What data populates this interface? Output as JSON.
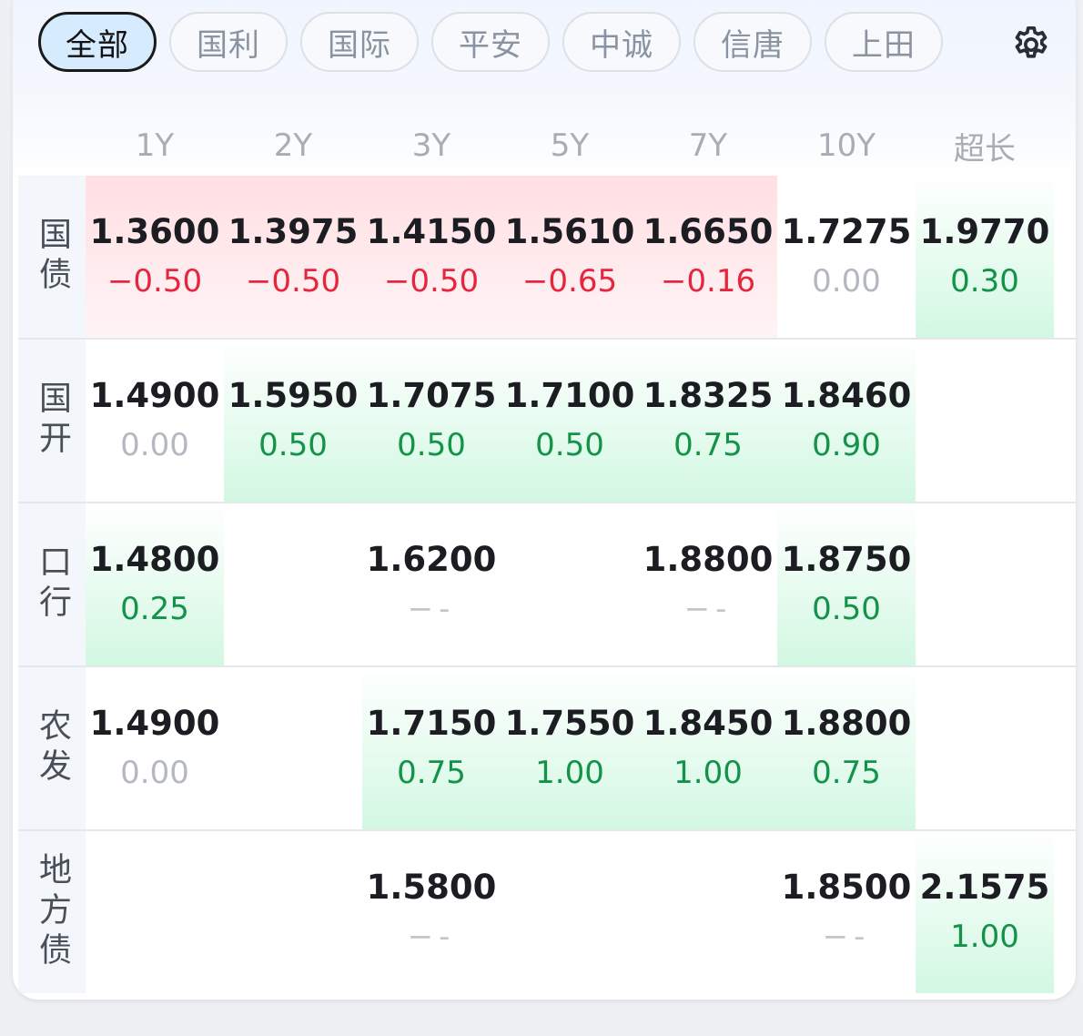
{
  "tabs": [
    {
      "label": "全部",
      "active": true
    },
    {
      "label": "国利",
      "active": false
    },
    {
      "label": "国际",
      "active": false
    },
    {
      "label": "平安",
      "active": false
    },
    {
      "label": "中诚",
      "active": false
    },
    {
      "label": "信唐",
      "active": false
    },
    {
      "label": "上田",
      "active": false
    }
  ],
  "settings_icon": "gear-icon",
  "columns": [
    "1Y",
    "2Y",
    "3Y",
    "5Y",
    "7Y",
    "10Y",
    "超长"
  ],
  "rows": [
    {
      "label": "国债",
      "cells": [
        {
          "rate": "1.3600",
          "change": "-0.50",
          "trend": "down"
        },
        {
          "rate": "1.3975",
          "change": "-0.50",
          "trend": "down"
        },
        {
          "rate": "1.4150",
          "change": "-0.50",
          "trend": "down"
        },
        {
          "rate": "1.5610",
          "change": "-0.65",
          "trend": "down"
        },
        {
          "rate": "1.6650",
          "change": "-0.16",
          "trend": "down"
        },
        {
          "rate": "1.7275",
          "change": "0.00",
          "trend": "flat"
        },
        {
          "rate": "1.9770",
          "change": "0.30",
          "trend": "up"
        }
      ]
    },
    {
      "label": "国开",
      "cells": [
        {
          "rate": "1.4900",
          "change": "0.00",
          "trend": "flat"
        },
        {
          "rate": "1.5950",
          "change": "0.50",
          "trend": "up"
        },
        {
          "rate": "1.7075",
          "change": "0.50",
          "trend": "up"
        },
        {
          "rate": "1.7100",
          "change": "0.50",
          "trend": "up"
        },
        {
          "rate": "1.8325",
          "change": "0.75",
          "trend": "up"
        },
        {
          "rate": "1.8460",
          "change": "0.90",
          "trend": "up"
        },
        null
      ]
    },
    {
      "label": "口行",
      "cells": [
        {
          "rate": "1.4800",
          "change": "0.25",
          "trend": "up"
        },
        null,
        {
          "rate": "1.6200",
          "change": "--",
          "trend": "na"
        },
        null,
        {
          "rate": "1.8800",
          "change": "--",
          "trend": "na"
        },
        {
          "rate": "1.8750",
          "change": "0.50",
          "trend": "up"
        },
        null
      ]
    },
    {
      "label": "农发",
      "cells": [
        {
          "rate": "1.4900",
          "change": "0.00",
          "trend": "flat"
        },
        null,
        {
          "rate": "1.7150",
          "change": "0.75",
          "trend": "up"
        },
        {
          "rate": "1.7550",
          "change": "1.00",
          "trend": "up"
        },
        {
          "rate": "1.8450",
          "change": "1.00",
          "trend": "up"
        },
        {
          "rate": "1.8800",
          "change": "0.75",
          "trend": "up"
        },
        null
      ]
    },
    {
      "label": "地方债",
      "cells": [
        null,
        null,
        {
          "rate": "1.5800",
          "change": "--",
          "trend": "na"
        },
        null,
        null,
        {
          "rate": "1.8500",
          "change": "--",
          "trend": "na"
        },
        {
          "rate": "2.1575",
          "change": "1.00",
          "trend": "up"
        }
      ]
    }
  ],
  "colors": {
    "down_text": "#e5263f",
    "up_text": "#13934a",
    "flat_text": "#b4b8c0",
    "down_bg": "#ffdfe3",
    "up_bg": "#d2f8e2",
    "active_tab_bg": "#d7ebff"
  }
}
